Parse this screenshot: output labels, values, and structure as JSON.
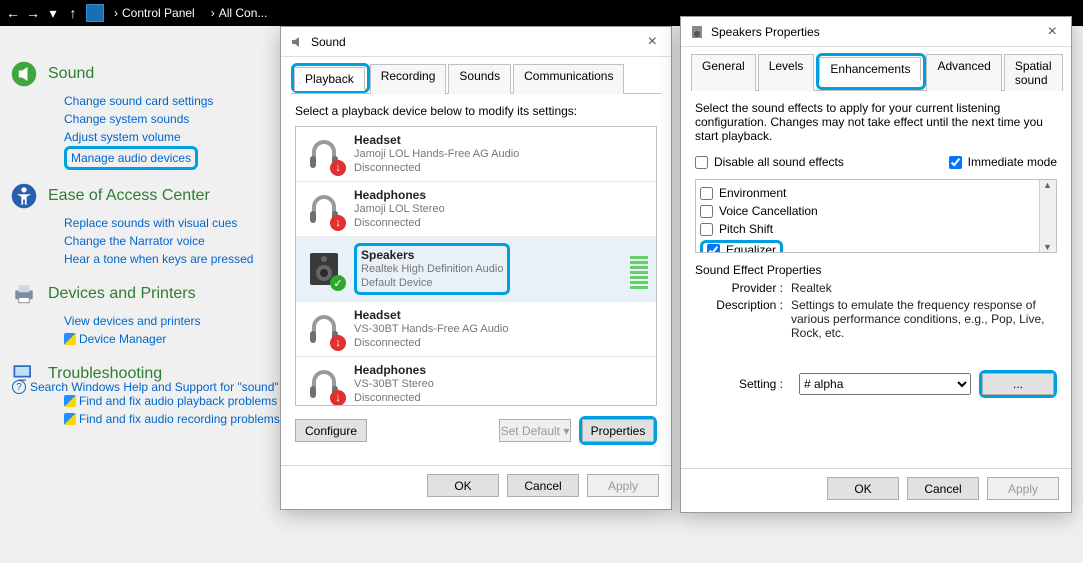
{
  "nav": {
    "path1": "Control Panel",
    "path2": "All Con..."
  },
  "cp": {
    "sound": {
      "title": "Sound",
      "links": [
        "Change sound card settings",
        "Change system sounds",
        "Adjust system volume",
        "Manage audio devices"
      ]
    },
    "ease": {
      "title": "Ease of Access Center",
      "links": [
        "Replace sounds with visual cues",
        "Change the Narrator voice",
        "Hear a tone when keys are pressed"
      ]
    },
    "dev": {
      "title": "Devices and Printers",
      "links": [
        "View devices and printers",
        "Device Manager"
      ]
    },
    "trouble": {
      "title": "Troubleshooting",
      "links": [
        "Find and fix audio playback problems",
        "Find and fix audio recording problems"
      ]
    },
    "help": "Search Windows Help and Support for \"sound\""
  },
  "soundDlg": {
    "title": "Sound",
    "tabs": [
      "Playback",
      "Recording",
      "Sounds",
      "Communications"
    ],
    "instr": "Select a playback device below to modify its settings:",
    "devices": [
      {
        "title": "Headset",
        "line2": "Jamoji LOL Hands-Free AG Audio",
        "line3": "Disconnected",
        "badge": "down"
      },
      {
        "title": "Headphones",
        "line2": "Jamoji LOL Stereo",
        "line3": "Disconnected",
        "badge": "down"
      },
      {
        "title": "Speakers",
        "line2": "Realtek High Definition Audio",
        "line3": "Default Device",
        "badge": "ok",
        "selected": true,
        "vu": true
      },
      {
        "title": "Headset",
        "line2": "VS-30BT Hands-Free AG Audio",
        "line3": "Disconnected",
        "badge": "down"
      },
      {
        "title": "Headphones",
        "line2": "VS-30BT Stereo",
        "line3": "Disconnected",
        "badge": "down"
      }
    ],
    "configure": "Configure",
    "setDefault": "Set Default",
    "properties": "Properties",
    "ok": "OK",
    "cancel": "Cancel",
    "apply": "Apply"
  },
  "propDlg": {
    "title": "Speakers Properties",
    "tabs": [
      "General",
      "Levels",
      "Enhancements",
      "Advanced",
      "Spatial sound"
    ],
    "instr": "Select the sound effects to apply for your current listening configuration. Changes may not take effect until the next time you start playback.",
    "disableAll": "Disable all sound effects",
    "immediate": "Immediate mode",
    "effects": [
      "Environment",
      "Voice Cancellation",
      "Pitch Shift",
      "Equalizer"
    ],
    "fxTitle": "Sound Effect Properties",
    "provider_k": "Provider :",
    "provider_v": "Realtek",
    "desc_k": "Description :",
    "desc_v": "Settings to emulate the frequency response of various performance conditions,  e.g., Pop, Live, Rock, etc.",
    "setting_k": "Setting :",
    "setting_v": "# alpha",
    "dots": "...",
    "ok": "OK",
    "cancel": "Cancel",
    "apply": "Apply"
  }
}
